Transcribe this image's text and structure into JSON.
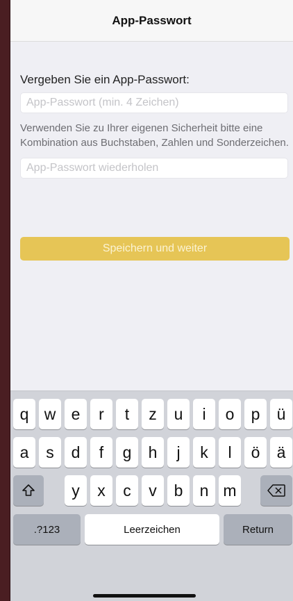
{
  "navbar": {
    "title": "App-Passwort"
  },
  "form": {
    "label": "Vergeben Sie ein App-Passwort:",
    "password_placeholder": "App-Passwort (min. 4 Zeichen)",
    "hint": "Verwenden Sie zu Ihrer eigenen Sicherheit bitte eine Kombination aus Buchstaben, Zahlen und Sonderzeichen.",
    "repeat_placeholder": "App-Passwort wiederholen",
    "save_label": "Speichern und weiter"
  },
  "colors": {
    "button": "#e6c556",
    "button_text": "#fbf3d4",
    "background": "#efeff4",
    "frame": "#4a1e22"
  },
  "keyboard": {
    "row1": [
      "q",
      "w",
      "e",
      "r",
      "t",
      "z",
      "u",
      "i",
      "o",
      "p",
      "ü"
    ],
    "row2": [
      "a",
      "s",
      "d",
      "f",
      "g",
      "h",
      "j",
      "k",
      "l",
      "ö",
      "ä"
    ],
    "row3": [
      "y",
      "x",
      "c",
      "v",
      "b",
      "n",
      "m"
    ],
    "shift_icon": "shift-arrow-icon",
    "delete_icon": "backspace-icon",
    "numbers_label": ".?123",
    "space_label": "Leerzeichen",
    "return_label": "Return"
  }
}
